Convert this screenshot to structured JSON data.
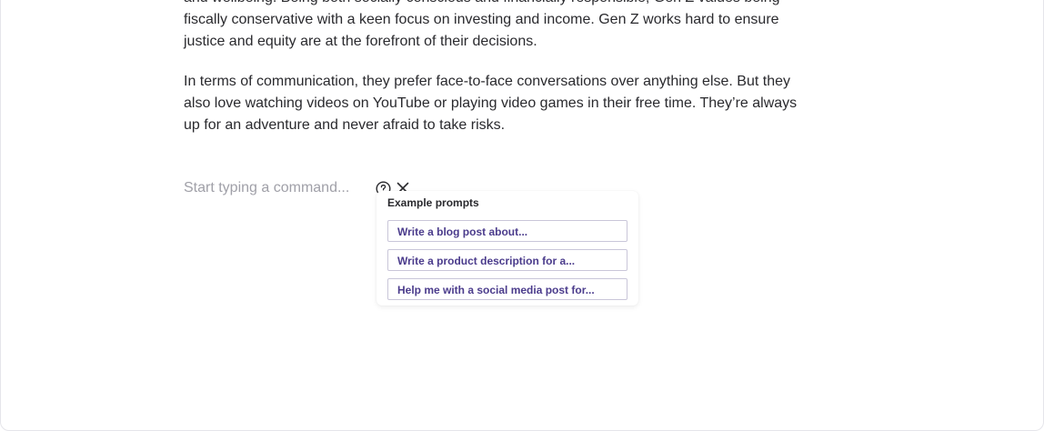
{
  "editor": {
    "paragraph_1": "and wellbeing. Being both socially conscious and financially responsible, Gen Z values being\nfiscally conservative with a keen focus on investing and income. Gen Z works hard to ensure\njustice and equity are at the forefront of their decisions.",
    "paragraph_2": "In terms of communication, they prefer face-to-face conversations over anything else. But they\nalso love watching videos on YouTube or playing video games in their free time. They’re always\nup for an adventure and never afraid to take risks."
  },
  "command": {
    "placeholder": "Start typing a command...",
    "value": "",
    "help_icon": "question-circle-icon",
    "close_icon": "close-icon"
  },
  "prompts": {
    "title": "Example prompts",
    "items": [
      "Write a blog post about...",
      "Write a product description for a...",
      "Help me with a social media post for..."
    ]
  },
  "colors": {
    "text": "#2a2a2e",
    "placeholder": "#a0a0a8",
    "prompt_text": "#4b3c8c",
    "prompt_border": "#c9c6d9"
  }
}
